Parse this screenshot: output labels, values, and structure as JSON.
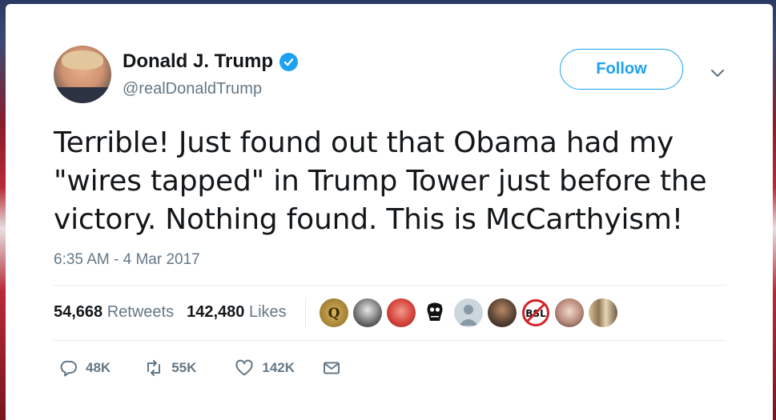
{
  "author": {
    "display_name": "Donald J. Trump",
    "handle": "@realDonaldTrump",
    "verified": true
  },
  "follow_button": {
    "label": "Follow"
  },
  "tweet": {
    "lines": [
      "Terrible! Just found out that Obama had my",
      "\"wires tapped\" in Trump Tower just before the",
      "victory. Nothing found. This is McCarthyism!"
    ],
    "timestamp": "6:35 AM - 4 Mar 2017"
  },
  "stats": {
    "retweets_count": "54,668",
    "retweets_label": "Retweets",
    "likes_count": "142,480",
    "likes_label": "Likes"
  },
  "actions": {
    "reply_count": "48K",
    "retweet_count": "55K",
    "like_count": "142K"
  },
  "liker_avatars": [
    "avatar-gold-q",
    "avatar-trump-bw",
    "avatar-red-face",
    "avatar-punisher-skull",
    "avatar-default-gray",
    "avatar-man-dark",
    "avatar-bsl-crossed",
    "avatar-child",
    "avatar-group-photo"
  ],
  "colors": {
    "accent": "#1da1f2",
    "text": "#14171a",
    "muted": "#657786",
    "divider": "#e6ecf0"
  }
}
